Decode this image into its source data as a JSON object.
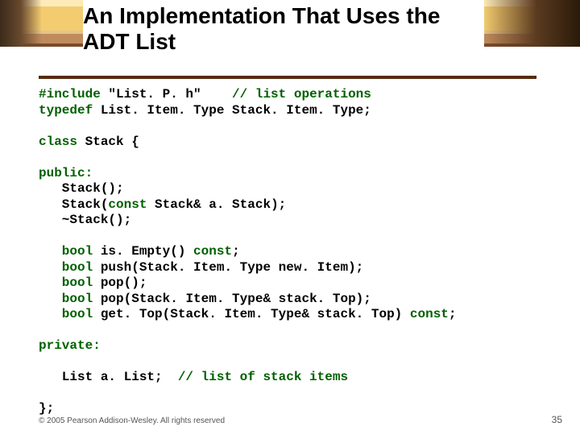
{
  "title": "An Implementation That Uses the ADT List",
  "code": {
    "l1a": "#include",
    "l1b": " \"List. P. h\"    ",
    "l1c": "// list operations",
    "l2a": "typedef",
    "l2b": " List. Item. Type Stack. Item. Type;",
    "l3": "class",
    "l3b": " Stack {",
    "l4": "public:",
    "l5": "   Stack();",
    "l6a": "   Stack(",
    "l6b": "const",
    "l6c": " Stack& a. Stack);",
    "l7": "   ~Stack();",
    "l8a": "   bool",
    "l8b": " is. Empty() ",
    "l8c": "const",
    "l8d": ";",
    "l9a": "   bool",
    "l9b": " push(Stack. Item. Type new. Item);",
    "l10a": "   bool",
    "l10b": " pop();",
    "l11a": "   bool",
    "l11b": " pop(Stack. Item. Type& stack. Top);",
    "l12a": "   bool",
    "l12b": " get. Top(Stack. Item. Type& stack. Top) ",
    "l12c": "const",
    "l12d": ";",
    "l13": "private:",
    "l14a": "   List a. List;  ",
    "l14b": "// list of stack items",
    "l15": "};"
  },
  "footer": "© 2005 Pearson Addison-Wesley. All rights reserved",
  "pagenum": "35"
}
